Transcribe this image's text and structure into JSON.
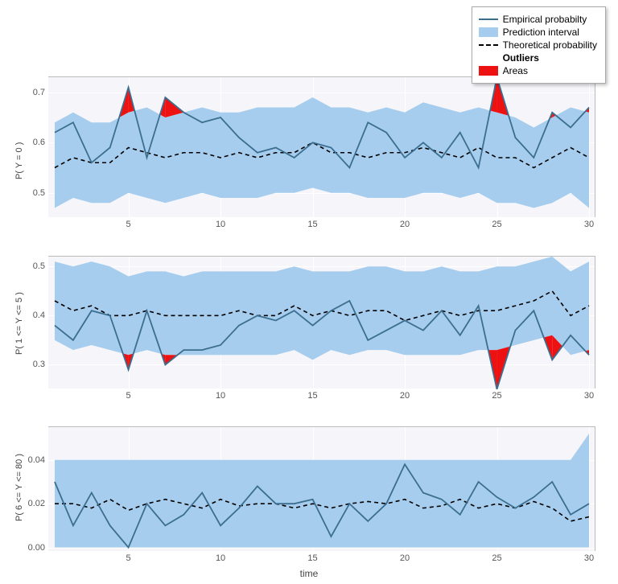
{
  "legend": {
    "empirical": "Empirical probabilty",
    "interval": "Prediction interval",
    "theoretical": "Theoretical probability",
    "outliers_header": "Outliers",
    "areas": "Areas"
  },
  "xlabel": "time",
  "panels": [
    {
      "ylabel": "P( Y = 0 )"
    },
    {
      "ylabel": "P( 1 <= Y <= 5 )"
    },
    {
      "ylabel": "P( 6 <= Y <= 80 )"
    }
  ],
  "chart_data": [
    {
      "type": "line",
      "title": "",
      "xlabel": "time",
      "ylabel": "P( Y = 0 )",
      "xlim": [
        1,
        30
      ],
      "ylim": [
        0.45,
        0.73
      ],
      "x": [
        1,
        2,
        3,
        4,
        5,
        6,
        7,
        8,
        9,
        10,
        11,
        12,
        13,
        14,
        15,
        16,
        17,
        18,
        19,
        20,
        21,
        22,
        23,
        24,
        25,
        26,
        27,
        28,
        29,
        30
      ],
      "series": [
        {
          "name": "Empirical probabilty",
          "values": [
            0.62,
            0.64,
            0.56,
            0.59,
            0.71,
            0.57,
            0.69,
            0.66,
            0.64,
            0.65,
            0.61,
            0.58,
            0.59,
            0.57,
            0.6,
            0.59,
            0.55,
            0.64,
            0.62,
            0.57,
            0.6,
            0.57,
            0.62,
            0.55,
            0.73,
            0.61,
            0.57,
            0.66,
            0.63,
            0.67
          ]
        },
        {
          "name": "Theoretical probability",
          "values": [
            0.55,
            0.57,
            0.56,
            0.56,
            0.59,
            0.58,
            0.57,
            0.58,
            0.58,
            0.57,
            0.58,
            0.57,
            0.58,
            0.58,
            0.6,
            0.58,
            0.58,
            0.57,
            0.58,
            0.58,
            0.59,
            0.58,
            0.57,
            0.59,
            0.57,
            0.57,
            0.55,
            0.57,
            0.59,
            0.57
          ]
        },
        {
          "name": "Prediction interval upper",
          "values": [
            0.64,
            0.66,
            0.64,
            0.64,
            0.66,
            0.67,
            0.65,
            0.66,
            0.67,
            0.66,
            0.66,
            0.67,
            0.67,
            0.67,
            0.69,
            0.67,
            0.67,
            0.66,
            0.67,
            0.66,
            0.68,
            0.67,
            0.66,
            0.67,
            0.66,
            0.65,
            0.63,
            0.65,
            0.67,
            0.66
          ]
        },
        {
          "name": "Prediction interval lower",
          "values": [
            0.47,
            0.49,
            0.48,
            0.48,
            0.5,
            0.49,
            0.48,
            0.49,
            0.5,
            0.49,
            0.49,
            0.49,
            0.5,
            0.5,
            0.51,
            0.5,
            0.5,
            0.49,
            0.49,
            0.49,
            0.5,
            0.5,
            0.49,
            0.5,
            0.48,
            0.48,
            0.47,
            0.48,
            0.5,
            0.47
          ]
        }
      ],
      "yticks": [
        0.5,
        0.6,
        0.7
      ],
      "xticks": [
        5,
        10,
        15,
        20,
        25,
        30
      ]
    },
    {
      "type": "line",
      "title": "",
      "xlabel": "time",
      "ylabel": "P( 1 <= Y <= 5 )",
      "xlim": [
        1,
        30
      ],
      "ylim": [
        0.25,
        0.52
      ],
      "x": [
        1,
        2,
        3,
        4,
        5,
        6,
        7,
        8,
        9,
        10,
        11,
        12,
        13,
        14,
        15,
        16,
        17,
        18,
        19,
        20,
        21,
        22,
        23,
        24,
        25,
        26,
        27,
        28,
        29,
        30
      ],
      "series": [
        {
          "name": "Empirical probabilty",
          "values": [
            0.38,
            0.35,
            0.41,
            0.4,
            0.29,
            0.41,
            0.3,
            0.33,
            0.33,
            0.34,
            0.38,
            0.4,
            0.39,
            0.41,
            0.38,
            0.41,
            0.43,
            0.35,
            0.37,
            0.39,
            0.37,
            0.41,
            0.36,
            0.42,
            0.25,
            0.37,
            0.41,
            0.31,
            0.36,
            0.32
          ]
        },
        {
          "name": "Theoretical probability",
          "values": [
            0.43,
            0.41,
            0.42,
            0.4,
            0.4,
            0.41,
            0.4,
            0.4,
            0.4,
            0.4,
            0.41,
            0.4,
            0.4,
            0.42,
            0.4,
            0.41,
            0.4,
            0.41,
            0.41,
            0.39,
            0.4,
            0.41,
            0.4,
            0.41,
            0.41,
            0.42,
            0.43,
            0.45,
            0.4,
            0.42
          ]
        },
        {
          "name": "Prediction interval upper",
          "values": [
            0.51,
            0.5,
            0.51,
            0.5,
            0.48,
            0.49,
            0.49,
            0.48,
            0.49,
            0.49,
            0.49,
            0.49,
            0.49,
            0.5,
            0.49,
            0.49,
            0.49,
            0.5,
            0.5,
            0.49,
            0.49,
            0.5,
            0.49,
            0.49,
            0.5,
            0.5,
            0.51,
            0.52,
            0.49,
            0.51
          ]
        },
        {
          "name": "Prediction interval lower",
          "values": [
            0.35,
            0.33,
            0.34,
            0.33,
            0.32,
            0.33,
            0.32,
            0.32,
            0.32,
            0.32,
            0.32,
            0.32,
            0.32,
            0.33,
            0.31,
            0.33,
            0.32,
            0.33,
            0.33,
            0.32,
            0.32,
            0.32,
            0.32,
            0.33,
            0.33,
            0.34,
            0.35,
            0.36,
            0.32,
            0.33
          ]
        }
      ],
      "yticks": [
        0.3,
        0.4,
        0.5
      ],
      "xticks": [
        5,
        10,
        15,
        20,
        25,
        30
      ]
    },
    {
      "type": "line",
      "title": "",
      "xlabel": "time",
      "ylabel": "P( 6 <= Y <= 80 )",
      "xlim": [
        1,
        30
      ],
      "ylim": [
        -0.002,
        0.055
      ],
      "x": [
        1,
        2,
        3,
        4,
        5,
        6,
        7,
        8,
        9,
        10,
        11,
        12,
        13,
        14,
        15,
        16,
        17,
        18,
        19,
        20,
        21,
        22,
        23,
        24,
        25,
        26,
        27,
        28,
        29,
        30
      ],
      "series": [
        {
          "name": "Empirical probabilty",
          "values": [
            0.03,
            0.01,
            0.025,
            0.01,
            0.0,
            0.02,
            0.01,
            0.015,
            0.025,
            0.01,
            0.018,
            0.028,
            0.02,
            0.02,
            0.022,
            0.005,
            0.02,
            0.012,
            0.02,
            0.038,
            0.025,
            0.022,
            0.015,
            0.03,
            0.023,
            0.018,
            0.023,
            0.03,
            0.015,
            0.02
          ]
        },
        {
          "name": "Theoretical probability",
          "values": [
            0.02,
            0.02,
            0.018,
            0.022,
            0.017,
            0.02,
            0.022,
            0.02,
            0.018,
            0.022,
            0.019,
            0.02,
            0.02,
            0.018,
            0.02,
            0.018,
            0.02,
            0.021,
            0.02,
            0.022,
            0.018,
            0.019,
            0.022,
            0.018,
            0.02,
            0.018,
            0.021,
            0.018,
            0.012,
            0.014
          ]
        },
        {
          "name": "Prediction interval upper",
          "values": [
            0.04,
            0.04,
            0.04,
            0.04,
            0.04,
            0.04,
            0.04,
            0.04,
            0.04,
            0.04,
            0.04,
            0.04,
            0.04,
            0.04,
            0.04,
            0.04,
            0.04,
            0.04,
            0.04,
            0.04,
            0.04,
            0.04,
            0.04,
            0.04,
            0.04,
            0.04,
            0.04,
            0.04,
            0.04,
            0.052
          ]
        },
        {
          "name": "Prediction interval lower",
          "values": [
            0.0,
            0.0,
            0.0,
            0.0,
            0.0,
            0.0,
            0.0,
            0.0,
            0.0,
            0.0,
            0.0,
            0.0,
            0.0,
            0.0,
            0.0,
            0.0,
            0.0,
            0.0,
            0.0,
            0.0,
            0.0,
            0.0,
            0.0,
            0.0,
            0.0,
            0.0,
            0.0,
            0.0,
            0.0,
            0.0
          ]
        }
      ],
      "yticks": [
        0.0,
        0.02,
        0.04
      ],
      "xticks": [
        5,
        10,
        15,
        20,
        25,
        30
      ]
    }
  ]
}
